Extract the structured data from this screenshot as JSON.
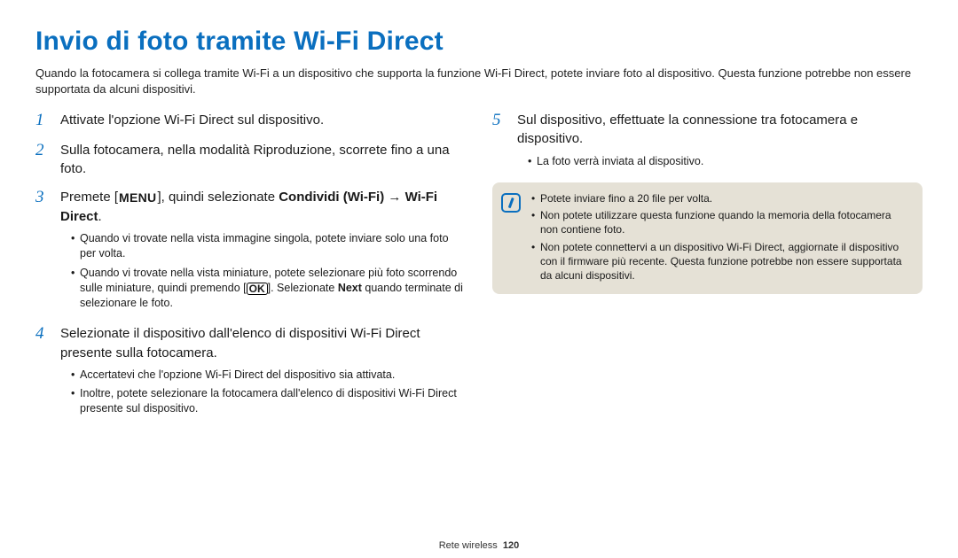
{
  "title": "Invio di foto tramite Wi-Fi Direct",
  "intro": "Quando la fotocamera si collega tramite Wi-Fi a un dispositivo che supporta la funzione Wi-Fi Direct, potete inviare foto al dispositivo. Questa funzione potrebbe non essere supportata da alcuni dispositivi.",
  "steps": {
    "1": {
      "num": "1",
      "text": "Attivate l'opzione Wi-Fi Direct sul dispositivo."
    },
    "2": {
      "num": "2",
      "text": "Sulla fotocamera, nella modalità Riproduzione, scorrete fino a una foto."
    },
    "3": {
      "num": "3",
      "prefix": "Premete [",
      "menu_label": "MENU",
      "mid": "], quindi selezionate ",
      "bold1": "Condividi (Wi-Fi)",
      "arrow": " → ",
      "bold2": "Wi-Fi Direct",
      "suffix": ".",
      "sub": [
        "Quando vi trovate nella vista immagine singola, potete inviare solo una foto per volta.",
        null
      ],
      "sub2_a": "Quando vi trovate nella vista miniature, potete selezionare più foto scorrendo sulle miniature, quindi premendo [",
      "ok_label": "OK",
      "sub2_b": "]. Selezionate ",
      "sub2_next": "Next",
      "sub2_c": " quando terminate di selezionare le foto."
    },
    "4": {
      "num": "4",
      "text": "Selezionate il dispositivo dall'elenco di dispositivi Wi-Fi Direct presente sulla fotocamera.",
      "sub": [
        "Accertatevi che l'opzione Wi-Fi Direct del dispositivo sia attivata.",
        "Inoltre, potete selezionare la fotocamera dall'elenco di dispositivi Wi-Fi Direct presente sul dispositivo."
      ]
    },
    "5": {
      "num": "5",
      "text": "Sul dispositivo, effettuate la connessione tra fotocamera e dispositivo.",
      "sub": [
        "La foto verrà inviata al dispositivo."
      ]
    }
  },
  "note": {
    "items": [
      "Potete inviare fino a 20 file per volta.",
      "Non potete utilizzare questa funzione quando la memoria della fotocamera non contiene foto.",
      "Non potete connettervi a un dispositivo Wi-Fi Direct, aggiornate il dispositivo con il firmware più recente. Questa funzione potrebbe non essere supportata da alcuni dispositivi."
    ]
  },
  "footer": {
    "section": "Rete wireless",
    "page": "120"
  }
}
